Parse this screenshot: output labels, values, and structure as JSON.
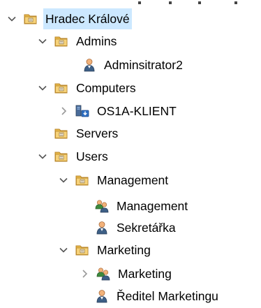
{
  "tree": {
    "items": [
      {
        "label": "Hradec Králové",
        "icon": "ou-folder-icon",
        "expander": "expanded",
        "selected": true
      },
      {
        "label": "Admins",
        "icon": "ou-folder-icon",
        "expander": "expanded"
      },
      {
        "label": "Adminsitrator2",
        "icon": "user-icon",
        "expander": "none"
      },
      {
        "label": "Computers",
        "icon": "ou-folder-icon",
        "expander": "expanded"
      },
      {
        "label": "OS1A-KLIENT",
        "icon": "computer-icon",
        "expander": "collapsed"
      },
      {
        "label": "Servers",
        "icon": "ou-folder-icon",
        "expander": "none"
      },
      {
        "label": "Users",
        "icon": "ou-folder-icon",
        "expander": "expanded"
      },
      {
        "label": "Management",
        "icon": "ou-folder-icon",
        "expander": "expanded"
      },
      {
        "label": "Management",
        "icon": "group-icon",
        "expander": "none"
      },
      {
        "label": "Sekretářka",
        "icon": "user-icon",
        "expander": "none"
      },
      {
        "label": "Marketing",
        "icon": "ou-folder-icon",
        "expander": "expanded"
      },
      {
        "label": "Marketing",
        "icon": "group-icon",
        "expander": "collapsed"
      },
      {
        "label": "Ředitel Marketingu",
        "icon": "user-icon",
        "expander": "none"
      }
    ]
  },
  "colors": {
    "selection": "#cce8ff",
    "folder": "#e8b84a",
    "chevron": "#555555"
  }
}
